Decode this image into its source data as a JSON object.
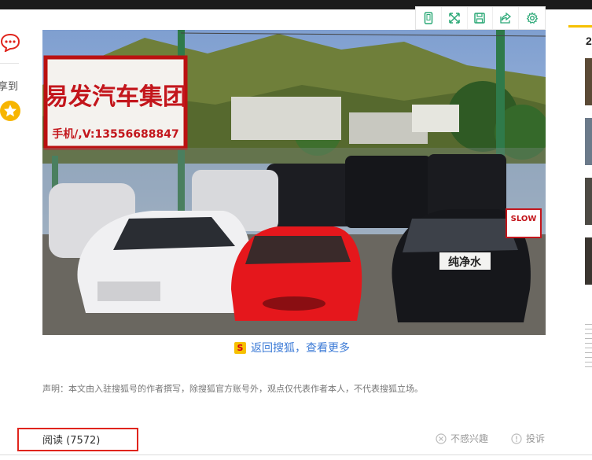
{
  "sidebar_left": {
    "comment_icon": "comment-bubble-icon",
    "share_label": "享到",
    "favorite_icon": "star-icon"
  },
  "image_toolbar": {
    "items": [
      {
        "icon": "mobile-icon"
      },
      {
        "icon": "fullscreen-icon"
      },
      {
        "icon": "save-icon"
      },
      {
        "icon": "share-icon"
      },
      {
        "icon": "settings-icon"
      }
    ]
  },
  "photo": {
    "sign_title": "易发汽车集团",
    "sign_phone": "手机/,V:13556688847",
    "car_plate_text": "纯净水",
    "slow_sign": "SLOW"
  },
  "back_link": {
    "logo": "S",
    "text": "返回搜狐，查看更多"
  },
  "disclaimer": "声明：本文由入驻搜狐号的作者撰写，除搜狐官方账号外，观点仅代表作者本人，不代表搜狐立场。",
  "footer": {
    "read_label": "阅读 (7572)",
    "not_interested": "不感兴趣",
    "report": "投诉"
  },
  "right_sidebar": {
    "heading_number": "2"
  },
  "colors": {
    "highlight_box": "#e0251d",
    "link_blue": "#3b7ad6",
    "accent_yellow": "#f6c000",
    "comment_red": "#e0251d"
  }
}
